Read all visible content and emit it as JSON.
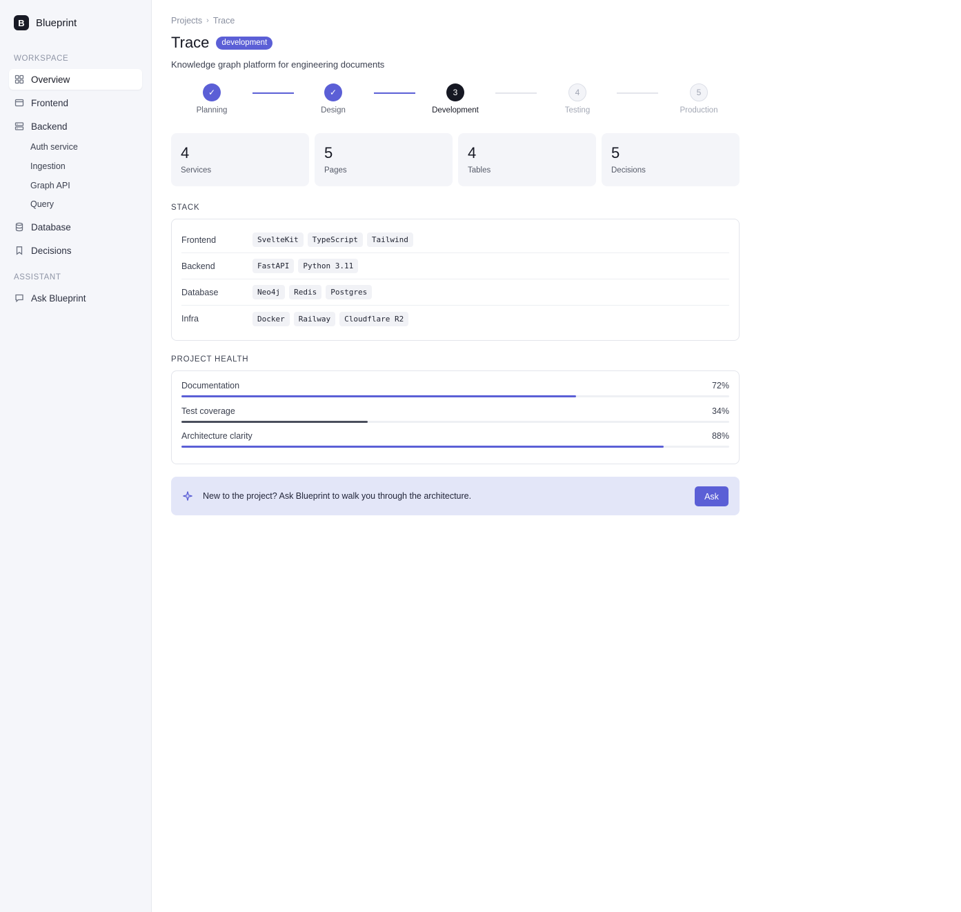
{
  "app": {
    "logo_letter": "B",
    "name": "Blueprint"
  },
  "sidebar": {
    "workspace_label": "WORKSPACE",
    "assistant_label": "ASSISTANT",
    "items": [
      {
        "label": "Overview",
        "icon": "grid-icon",
        "active": true
      },
      {
        "label": "Frontend",
        "icon": "window-icon",
        "active": false
      },
      {
        "label": "Backend",
        "icon": "server-icon",
        "active": false
      },
      {
        "label": "Database",
        "icon": "database-icon",
        "active": false
      },
      {
        "label": "Decisions",
        "icon": "bookmark-icon",
        "active": false
      }
    ],
    "backend_children": [
      "Auth service",
      "Ingestion",
      "Graph API",
      "Query"
    ],
    "assistant_items": [
      {
        "label": "Ask Blueprint",
        "icon": "chat-icon"
      }
    ]
  },
  "breadcrumb": {
    "root": "Projects",
    "separator": "›",
    "current": "Trace"
  },
  "header": {
    "title": "Trace",
    "badge": "development",
    "subtitle": "Knowledge graph platform for engineering documents"
  },
  "stepper": {
    "steps": [
      {
        "number": "1",
        "label": "Planning",
        "state": "done"
      },
      {
        "number": "2",
        "label": "Design",
        "state": "done"
      },
      {
        "number": "3",
        "label": "Development",
        "state": "current"
      },
      {
        "number": "4",
        "label": "Testing",
        "state": "todo"
      },
      {
        "number": "5",
        "label": "Production",
        "state": "todo"
      }
    ],
    "check_glyph": "✓"
  },
  "stats": [
    {
      "value": "4",
      "label": "Services"
    },
    {
      "value": "5",
      "label": "Pages"
    },
    {
      "value": "4",
      "label": "Tables"
    },
    {
      "value": "5",
      "label": "Decisions"
    }
  ],
  "stack": {
    "title": "STACK",
    "rows": [
      {
        "name": "Frontend",
        "chips": [
          "SvelteKit",
          "TypeScript",
          "Tailwind"
        ]
      },
      {
        "name": "Backend",
        "chips": [
          "FastAPI",
          "Python 3.11"
        ]
      },
      {
        "name": "Database",
        "chips": [
          "Neo4j",
          "Redis",
          "Postgres"
        ]
      },
      {
        "name": "Infra",
        "chips": [
          "Docker",
          "Railway",
          "Cloudflare R2"
        ]
      }
    ]
  },
  "health": {
    "title": "PROJECT HEALTH",
    "metrics": [
      {
        "label": "Documentation",
        "percent_text": "72%",
        "value": 0.72,
        "color": "#5b5fd6"
      },
      {
        "label": "Test coverage",
        "percent_text": "34%",
        "value": 0.34,
        "color": "#4a4e5c"
      },
      {
        "label": "Architecture clarity",
        "percent_text": "88%",
        "value": 0.88,
        "color": "#5b5fd6"
      }
    ]
  },
  "banner": {
    "text": "New to the project? Ask Blueprint to walk you through the architecture.",
    "button_label": "Ask",
    "icon": "sparkle-icon"
  },
  "colors": {
    "accent": "#5b5fd6",
    "dark": "#161823",
    "sidebar_bg": "#f5f6fa",
    "banner_bg": "#e3e6f8"
  }
}
